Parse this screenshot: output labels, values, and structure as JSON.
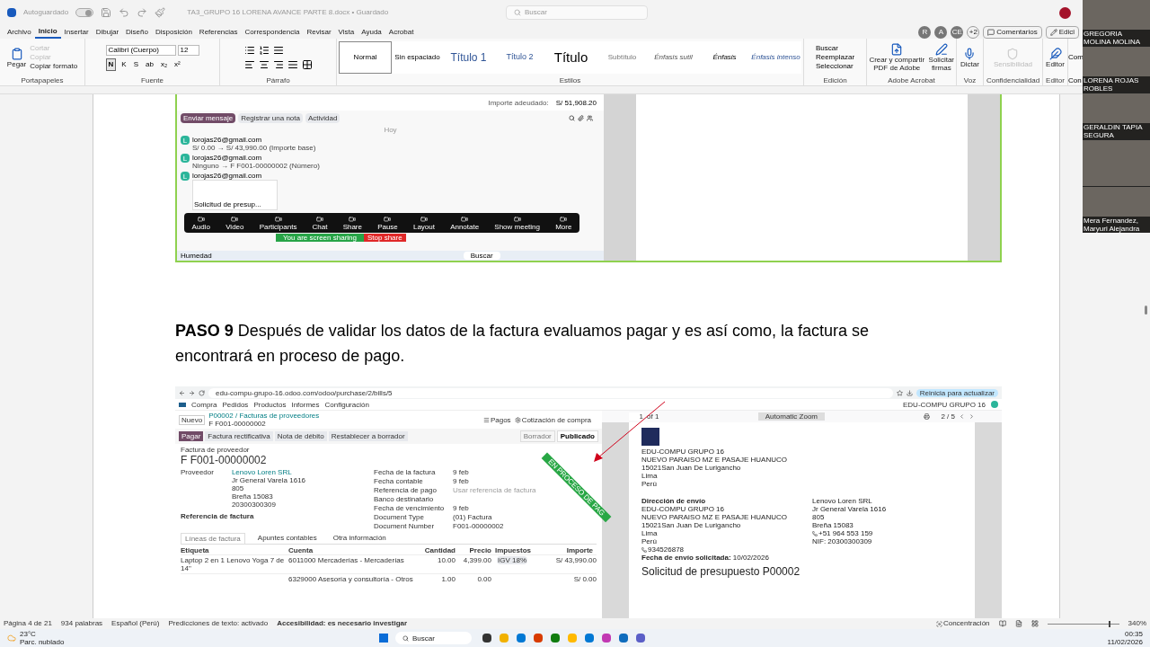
{
  "title_bar": {
    "autosave_label": "Autoguardado",
    "autosave_on": true,
    "document_title": "TA3_GRUPO 16 LORENA AVANCE PARTE 8.docx • Guardado",
    "search_placeholder": "Buscar"
  },
  "menu_tabs": [
    {
      "label": "Archivo",
      "selected": false
    },
    {
      "label": "Inicio",
      "selected": true
    },
    {
      "label": "Insertar",
      "selected": false
    },
    {
      "label": "Dibujar",
      "selected": false
    },
    {
      "label": "Diseño",
      "selected": false
    },
    {
      "label": "Disposición",
      "selected": false
    },
    {
      "label": "Referencias",
      "selected": false
    },
    {
      "label": "Correspondencia",
      "selected": false
    },
    {
      "label": "Revisar",
      "selected": false
    },
    {
      "label": "Vista",
      "selected": false
    },
    {
      "label": "Ayuda",
      "selected": false
    },
    {
      "label": "Acrobat",
      "selected": false
    }
  ],
  "collaborators": {
    "avatars": [
      "R",
      "A",
      "CE"
    ],
    "more": "+2",
    "comments_button": "Comentarios",
    "editing_button": "Edici"
  },
  "ribbon": {
    "clipboard": {
      "paste": "Pegar",
      "items": [
        {
          "label": "Cortar",
          "disabled": true
        },
        {
          "label": "Copiar",
          "disabled": true
        },
        {
          "label": "Copiar formato",
          "disabled": false
        }
      ],
      "label": "Portapapeles"
    },
    "font": {
      "font_name": "Calibri (Cuerpo)",
      "font_size": "12",
      "format_buttons": [
        {
          "label": "N",
          "selected": true
        },
        {
          "label": "K",
          "selected": false
        },
        {
          "label": "S",
          "selected": false
        },
        {
          "label": "ab",
          "selected": false
        },
        {
          "label": "x₂",
          "selected": false
        },
        {
          "label": "x²",
          "selected": false
        }
      ],
      "label": "Fuente"
    },
    "paragraph": {
      "label": "Párrafo"
    },
    "styles": {
      "items": [
        {
          "label": "Normal",
          "kind": "normal",
          "selected": true
        },
        {
          "label": "Sin espaciado",
          "kind": "no_spacing",
          "selected": false
        },
        {
          "label": "Título 1",
          "kind": "heading1",
          "selected": false
        },
        {
          "label": "Título 2",
          "kind": "heading2",
          "selected": false
        },
        {
          "label": "Título",
          "kind": "title",
          "selected": false
        },
        {
          "label": "Subtítulo",
          "kind": "subtitle",
          "selected": false
        },
        {
          "label": "Énfasis sutil",
          "kind": "subtle_emphasis",
          "selected": false
        },
        {
          "label": "Énfasis",
          "kind": "emphasis",
          "selected": false
        },
        {
          "label": "Énfasis intenso",
          "kind": "intense_emphasis",
          "selected": false
        }
      ],
      "label": "Estilos"
    },
    "editing": {
      "items": [
        "Buscar",
        "Reemplazar",
        "Seleccionar"
      ],
      "label": "Edición"
    },
    "acrobat": {
      "items": [
        "Crear y compartir PDF de Adobe",
        "Solicitar firmas"
      ],
      "label": "Adobe Acrobat"
    },
    "voice": {
      "button": "Dictar",
      "label": "Voz"
    },
    "sensitivity": {
      "button": "Sensibilidad",
      "disabled": true,
      "label": "Confidencialidad"
    },
    "editor": {
      "button": "Editor",
      "label": "Editor"
    },
    "cut_group": {
      "button": "Com",
      "label": "Con"
    }
  },
  "screenshot_1": {
    "amount_due_label": "Importe adeudado:",
    "amount_due": "S/ 51,908.20",
    "chatter_buttons": [
      {
        "label": "Enviar mensaje",
        "selected": true
      },
      {
        "label": "Registrar una nota",
        "selected": false
      },
      {
        "label": "Actividad",
        "selected": false
      }
    ],
    "date_divider": "Hoy",
    "messages": [
      {
        "avatar": "L",
        "author": "lorojas26@gmail.com",
        "text": "S/ 0.00 → S/ 43,990.00 (Importe base)"
      },
      {
        "avatar": "L",
        "author": "lorojas26@gmail.com",
        "text": "Ninguno → F F001-00000002 (Número)"
      },
      {
        "avatar": "L",
        "author": "lorojas26@gmail.com",
        "attachment": "Solicitud de presup..."
      }
    ],
    "meeting_toolbar": {
      "buttons": [
        "Audio",
        "Video",
        "Participants",
        "Chat",
        "Share",
        "Pause",
        "Layout",
        "Annotate",
        "Show meeting",
        "More"
      ],
      "sharing_notice": "You are screen sharing",
      "stop_button": "Stop share"
    },
    "taskbar": {
      "weather": "Humedad",
      "search": "Buscar"
    }
  },
  "paragraph": "**PASO 9** Después de validar los datos de la factura evaluamos pagar y es así como, la factura se encontrará en proceso de pago.",
  "screenshot_2": {
    "url": "edu-compu-grupo-16.odoo.com/odoo/purchase/2/bills/5",
    "update_button": "Reinicia para actualizar",
    "app_name": "Compra",
    "nav": [
      "Pedidos",
      "Productos",
      "Informes",
      "Configuración"
    ],
    "company": "EDU-COMPU GRUPO 16",
    "new_button": "Nuevo",
    "breadcrumb": "P00002 / Facturas de proveedores",
    "record": "F F001-00000002",
    "payments": "Pagos",
    "purchase_link": "Cotización de compra",
    "pager": "2 / 5",
    "actions": [
      {
        "label": "Pagar",
        "selected": true
      },
      {
        "label": "Factura rectificativa",
        "selected": false
      },
      {
        "label": "Nota de débito",
        "selected": false
      },
      {
        "label": "Restablecer a borrador",
        "selected": false
      }
    ],
    "statuses": [
      {
        "label": "Borrador",
        "selected": false
      },
      {
        "label": "Publicado",
        "selected": true
      }
    ],
    "ribbon_banner": "EN PROCESO DE PAG",
    "form_caption": "Factura de proveedor",
    "form_title": "F F001-00000002",
    "vendor_label": "Proveedor",
    "vendor_lines": [
      "Lenovo Loren SRL",
      "Jr General Varela 1616",
      "805",
      "Breña 15083",
      "20300300309"
    ],
    "invoice_ref_label": "Referencia de factura",
    "fields": [
      {
        "label": "Fecha de la factura",
        "value": "9 feb"
      },
      {
        "label": "Fecha contable",
        "value": "9 feb"
      },
      {
        "label": "Referencia de pago",
        "placeholder": "Usar referencia de factura"
      },
      {
        "label": "Banco destinatario"
      },
      {
        "label": "Fecha de vencimiento",
        "value": "9 feb"
      },
      {
        "label": "Document Type",
        "value": "(01) Factura"
      },
      {
        "label": "Document Number",
        "value": "F001-00000002"
      }
    ],
    "tabs": [
      {
        "label": "Líneas de factura",
        "selected": true
      },
      {
        "label": "Apuntes contables",
        "selected": false
      },
      {
        "label": "Otra información",
        "selected": false
      }
    ],
    "columns": [
      "Etiqueta",
      "Cuenta",
      "Cantidad",
      "Precio",
      "Impuestos",
      "Importe"
    ],
    "rows": [
      {
        "label": "Laptop 2 en 1 Lenovo Yoga 7 de 14\"",
        "account": "6011000 Mercaderías - Mercaderías",
        "quantity": "10.00",
        "price": "4,399.00",
        "tax": "IGV 18%",
        "amount": "S/ 43,990.00"
      },
      {
        "account": "6329000 Asesoría y consultoría - Otros",
        "quantity": "1.00",
        "price": "0.00",
        "amount": "S/ 0.00"
      }
    ],
    "pdf": {
      "page": "1",
      "page_count": "of 1",
      "zoom": "Automatic Zoom",
      "company_lines": [
        "EDU-COMPU GRUPO 16",
        "NUEVO PARAISO MZ E PASAJE HUANUCO",
        "15021San Juan De Lurigancho",
        "Lima",
        "Perú"
      ],
      "shipping_label": "Dirección de envío",
      "shipping_lines": [
        "EDU-COMPU GRUPO 16",
        "NUEVO PARAISO MZ E PASAJE HUANUCO",
        "15021San Juan De Lurigancho",
        "Lima",
        "Perú"
      ],
      "shipping_phone": "934526878",
      "requested_date": "**Fecha de envío solicitada:** 10/02/2026",
      "vendor_lines": [
        "Lenovo Loren SRL",
        "Jr General Varela 1616",
        "805",
        "Breña 15083"
      ],
      "vendor_phone": "+51 964 553 159",
      "vendor_tax_id": "NIF: 20300300309",
      "heading": "Solicitud de presupuesto P00002"
    }
  },
  "status_bar": {
    "page": "Página 4 de 21",
    "words": "934 palabras",
    "language": "Español (Perú)",
    "predictions": "Predicciones de texto: activado",
    "accessibility": "Accesibilidad: es necesario investigar",
    "focus": "Concentración",
    "zoom": "340%",
    "zoom_level": {
      "level": 0.85
    }
  },
  "taskbar": {
    "temperature": "23°C",
    "weather": "Parc. nublado",
    "search": "Buscar",
    "time": "00:35",
    "date": "11/02/2026"
  },
  "video_tiles": [
    {
      "kind": "named",
      "name": "GREGORIA MOLINA MOLINA"
    },
    {
      "kind": "named",
      "name": "LORENA ROJAS ROBLES"
    },
    {
      "kind": "named",
      "name": "GERALDIN TAPIA SEGURA"
    },
    {
      "kind": "unnamed"
    },
    {
      "kind": "named",
      "name": "Mera Fernandez, Maryuri Alejandra"
    }
  ]
}
